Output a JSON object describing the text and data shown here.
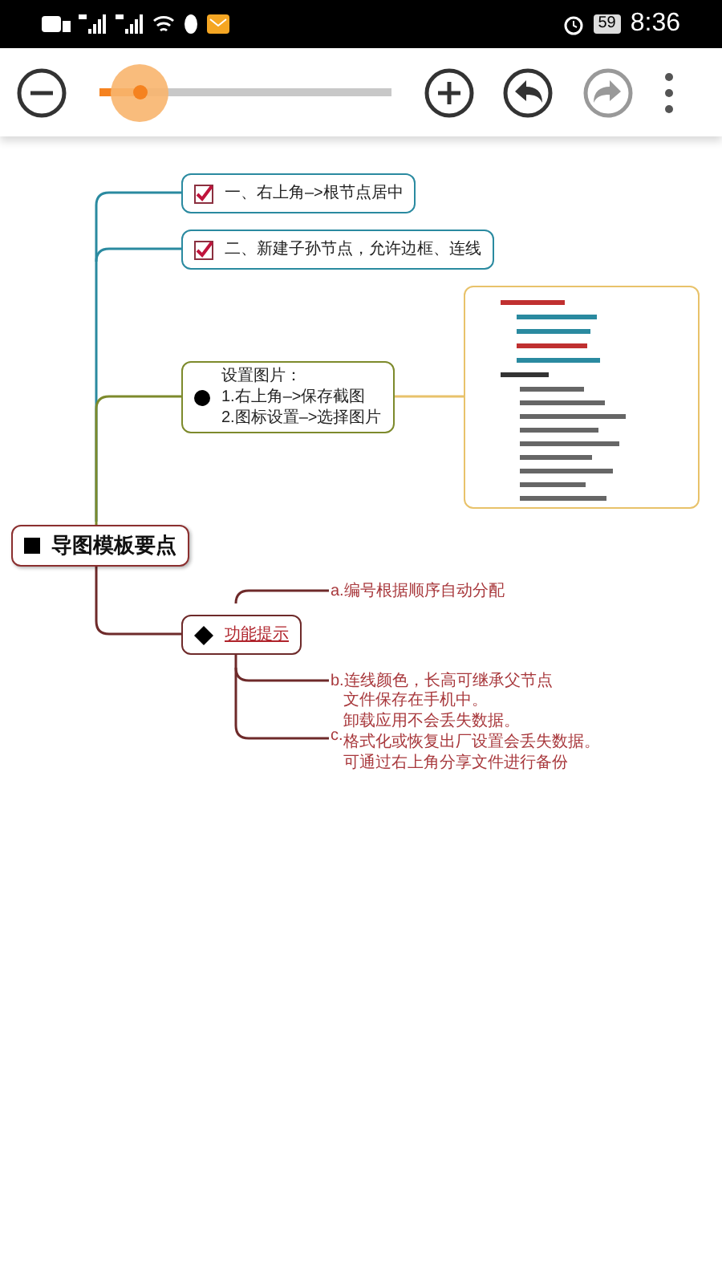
{
  "status_bar": {
    "battery": "59",
    "time": "8:36"
  },
  "toolbar": {
    "zoom": {
      "level": 0.14
    },
    "undo": {
      "disabled": false
    },
    "redo": {
      "disabled": true
    }
  },
  "mindmap": {
    "root": {
      "kind": "square",
      "text": "导图模板要点"
    },
    "branches": [
      {
        "kind": "check",
        "checked": true,
        "lines": [
          "一、右上角–>根节点居中"
        ]
      },
      {
        "kind": "check",
        "checked": true,
        "lines": [
          "二、新建子孙节点，允许边框、连线"
        ]
      },
      {
        "kind": "bullet",
        "lines": [
          "设置图片：",
          "1.右上角–>保存截图",
          "2.图标设置–>选择图片"
        ],
        "attachment": {
          "kind": "picture"
        }
      },
      {
        "kind": "diamond",
        "lines": [
          "功能提示"
        ],
        "children": [
          {
            "marker": "a.",
            "lines": [
              "编号根据顺序自动分配"
            ]
          },
          {
            "marker": "b.",
            "lines": [
              "连线颜色，长高可继承父节点"
            ]
          },
          {
            "marker": "c.",
            "lines": [
              "文件保存在手机中。",
              "卸载应用不会丢失数据。",
              "格式化或恢复出厂设置会丢失数据。",
              "可通过右上角分享文件进行备份"
            ]
          }
        ]
      }
    ]
  }
}
